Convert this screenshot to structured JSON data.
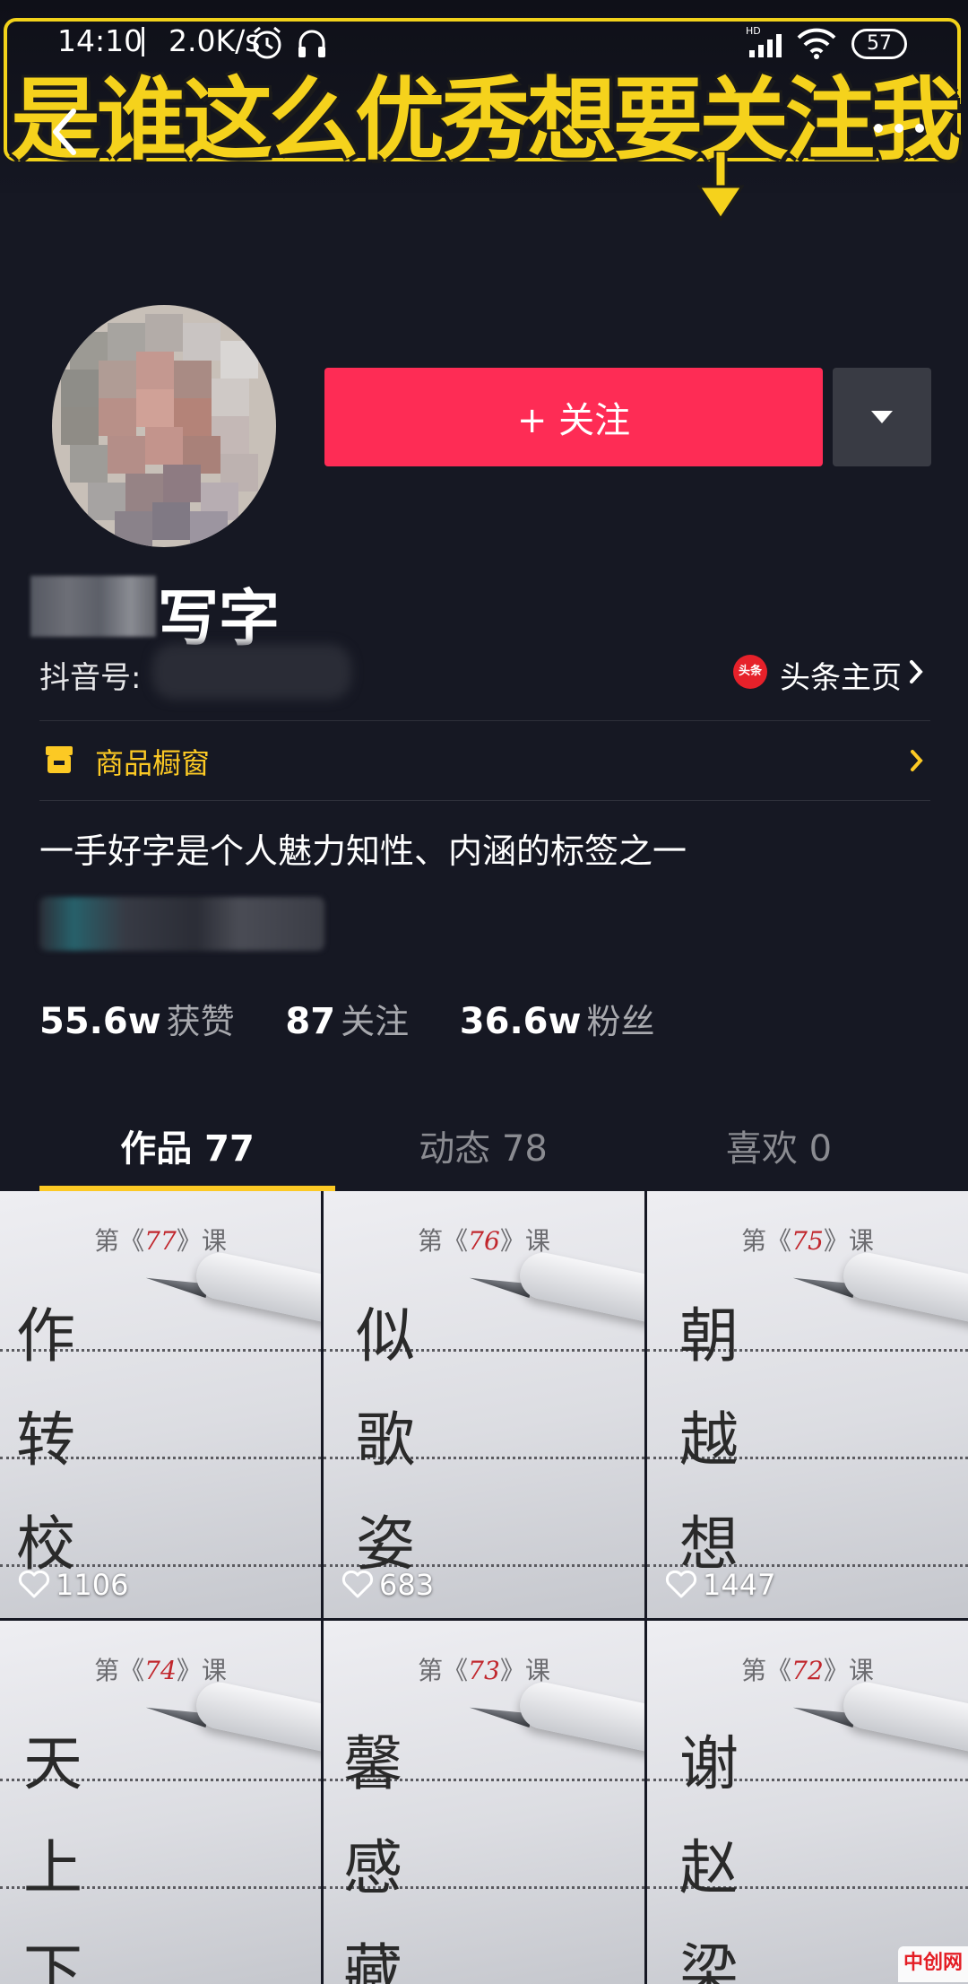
{
  "banner": {
    "text": "是谁这么优秀想要关注我"
  },
  "status_bar": {
    "time": "14:10",
    "speed": "2.0K/s",
    "battery": "57"
  },
  "profile": {
    "name_suffix": "写字",
    "douyin_id_label": "抖音号:",
    "toutiao_badge": "头条",
    "toutiao_link": "头条主页",
    "follow_button": "+ 关注",
    "shop_window": "商品橱窗",
    "bio": "一手好字是个人魅力知性、内涵的标签之一"
  },
  "stats": [
    {
      "value": "55.6w",
      "label": "获赞"
    },
    {
      "value": "87",
      "label": "关注"
    },
    {
      "value": "36.6w",
      "label": "粉丝"
    }
  ],
  "tabs": [
    {
      "label": "作品 77",
      "active": true
    },
    {
      "label": "动态 78",
      "active": false
    },
    {
      "label": "喜欢 0",
      "active": false
    }
  ],
  "videos": [
    {
      "lesson_pre": "第《",
      "lesson_num": "77",
      "lesson_post": "》课",
      "chars": [
        "作",
        "转",
        "校"
      ],
      "likes": "1106"
    },
    {
      "lesson_pre": "第《",
      "lesson_num": "76",
      "lesson_post": "》课",
      "chars": [
        "似",
        "歌",
        "姿"
      ],
      "likes": "683"
    },
    {
      "lesson_pre": "第《",
      "lesson_num": "75",
      "lesson_post": "》课",
      "chars": [
        "朝",
        "越",
        "想"
      ],
      "likes": "1447"
    },
    {
      "lesson_pre": "第《",
      "lesson_num": "74",
      "lesson_post": "》课",
      "chars": [
        "天",
        "上",
        "下"
      ],
      "likes": ""
    },
    {
      "lesson_pre": "第《",
      "lesson_num": "73",
      "lesson_post": "》课",
      "chars": [
        "馨",
        "感",
        "藏"
      ],
      "likes": ""
    },
    {
      "lesson_pre": "第《",
      "lesson_num": "72",
      "lesson_post": "》课",
      "chars": [
        "谢",
        "赵",
        "梁"
      ],
      "likes": ""
    }
  ],
  "watermark": "中创网",
  "colors": {
    "follow": "#fe2c55",
    "accent": "#fcc924",
    "background": "#161823",
    "banner_yellow": "#f5d21c"
  }
}
